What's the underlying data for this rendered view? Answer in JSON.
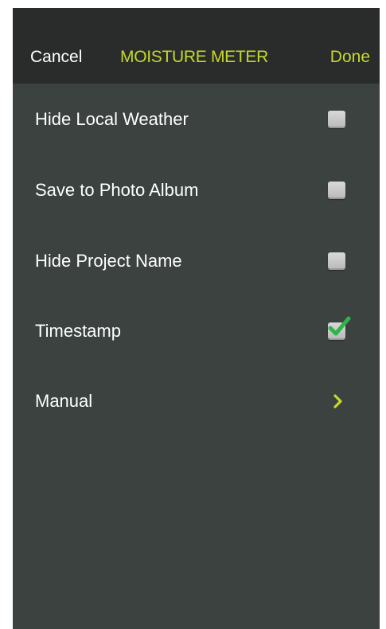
{
  "nav": {
    "cancel_label": "Cancel",
    "title": "MOISTURE METER",
    "done_label": "Done"
  },
  "settings": {
    "rows": [
      {
        "label": "Hide Local Weather",
        "control": "checkbox",
        "checked": false
      },
      {
        "label": "Save to Photo Album",
        "control": "checkbox",
        "checked": false
      },
      {
        "label": "Hide Project Name",
        "control": "checkbox",
        "checked": false
      },
      {
        "label": "Timestamp",
        "control": "checkbox",
        "checked": true
      },
      {
        "label": "Manual",
        "control": "chevron-right-icon"
      }
    ]
  },
  "colors": {
    "accent": "#c6d82a",
    "background": "#3b4240",
    "topbar": "#2a2c2b",
    "check": "#2fb34a"
  }
}
